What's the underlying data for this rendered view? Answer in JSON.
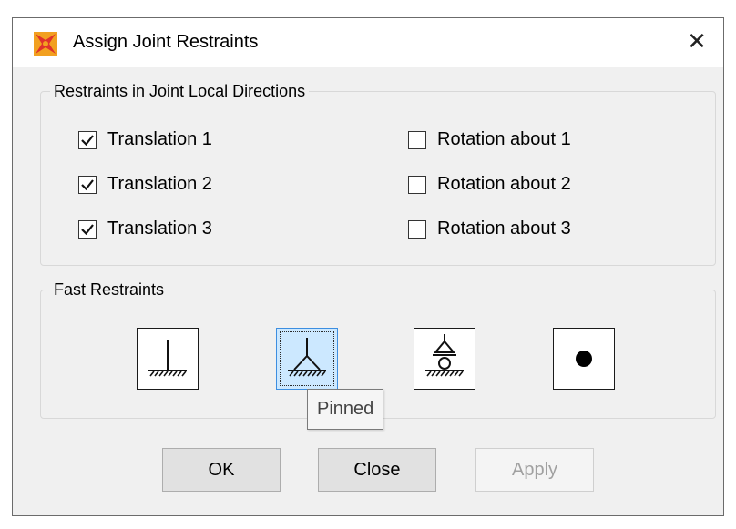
{
  "window": {
    "title": "Assign Joint Restraints",
    "close_glyph": "✕",
    "icon": "app-logo-icon"
  },
  "local_directions": {
    "legend": "Restraints in Joint Local Directions",
    "items": [
      {
        "label": "Translation 1",
        "checked": true
      },
      {
        "label": "Translation 2",
        "checked": true
      },
      {
        "label": "Translation 3",
        "checked": true
      },
      {
        "label": "Rotation about 1",
        "checked": false
      },
      {
        "label": "Rotation about 2",
        "checked": false
      },
      {
        "label": "Rotation about 3",
        "checked": false
      }
    ]
  },
  "fast_restraints": {
    "legend": "Fast Restraints",
    "buttons": [
      {
        "icon": "fixed-support-icon",
        "selected": false
      },
      {
        "icon": "pinned-support-icon",
        "selected": true
      },
      {
        "icon": "roller-support-icon",
        "selected": false
      },
      {
        "icon": "free-joint-icon",
        "selected": false
      }
    ],
    "tooltip": "Pinned"
  },
  "actions": {
    "ok": "OK",
    "close": "Close",
    "apply": "Apply"
  },
  "colors": {
    "selected_fill": "#cce8ff",
    "selected_border": "#3d8ee0",
    "icon_red": "#e0322b",
    "icon_orange": "#f2a020"
  }
}
